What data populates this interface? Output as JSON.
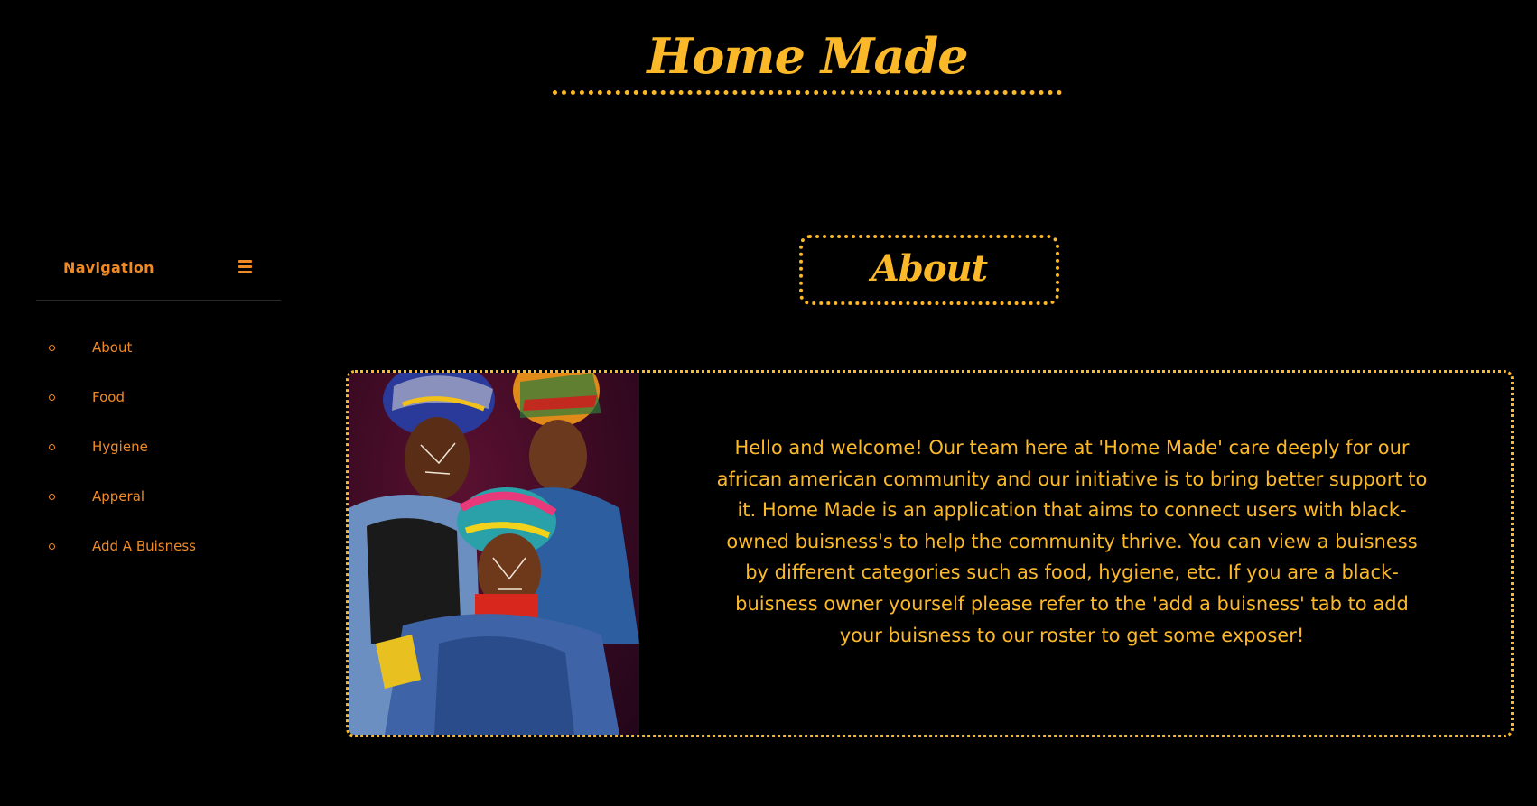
{
  "site": {
    "title": "Home Made"
  },
  "sidebar": {
    "title": "Navigation",
    "menu_icon": "hamburger-menu-icon",
    "items": [
      {
        "label": "About"
      },
      {
        "label": "Food"
      },
      {
        "label": "Hygiene"
      },
      {
        "label": "Apperal"
      },
      {
        "label": "Add A Buisness"
      }
    ]
  },
  "main": {
    "heading": "About",
    "body_text": "Hello and welcome! Our team here at 'Home Made' care deeply for our african american community and our initiative is to bring better support to it. Home Made is an application that aims to connect users with black-owned buisness's to help the community thrive. You can view a buisness by different categories such as food, hygiene, etc. If you are a black-buisness owner yourself please refer to the 'add a buisness' tab to add your buisness to our roster to get some exposer!"
  },
  "colors": {
    "background": "#000000",
    "accent_gold": "#fbb828",
    "nav_orange": "#f08a24"
  }
}
